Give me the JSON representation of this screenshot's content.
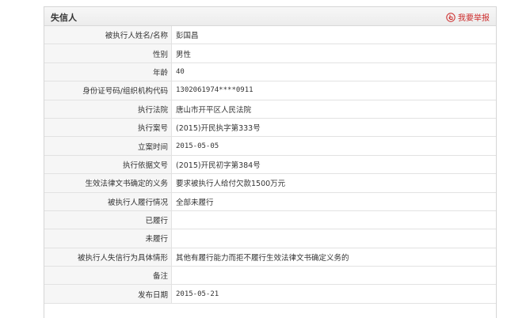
{
  "panel": {
    "title": "失信人",
    "report_label": "我要举报"
  },
  "rows": [
    {
      "label": "被执行人姓名/名称",
      "value": "彭国昌"
    },
    {
      "label": "性别",
      "value": "男性"
    },
    {
      "label": "年龄",
      "value": "40"
    },
    {
      "label": "身份证号码/组织机构代码",
      "value": "1302061974****0911"
    },
    {
      "label": "执行法院",
      "value": "唐山市开平区人民法院"
    },
    {
      "label": "执行案号",
      "value": "(2015)开民执字第333号"
    },
    {
      "label": "立案时间",
      "value": "2015-05-05"
    },
    {
      "label": "执行依据文号",
      "value": "(2015)开民初字第384号"
    },
    {
      "label": "生效法律文书确定的义务",
      "value": "要求被执行人给付欠款1500万元"
    },
    {
      "label": "被执行人履行情况",
      "value": "全部未履行"
    },
    {
      "label": "已履行",
      "value": ""
    },
    {
      "label": "未履行",
      "value": ""
    },
    {
      "label": "被执行人失信行为具体情形",
      "value": "其他有履行能力而拒不履行生效法律文书确定义务的"
    },
    {
      "label": "备注",
      "value": ""
    },
    {
      "label": "发布日期",
      "value": "2015-05-21"
    }
  ],
  "colors": {
    "accent": "#cc2a2a",
    "label_bg": "#f6f6f6",
    "border": "#e2e2e2"
  },
  "icons": {
    "report": "hand-pointer-icon"
  }
}
